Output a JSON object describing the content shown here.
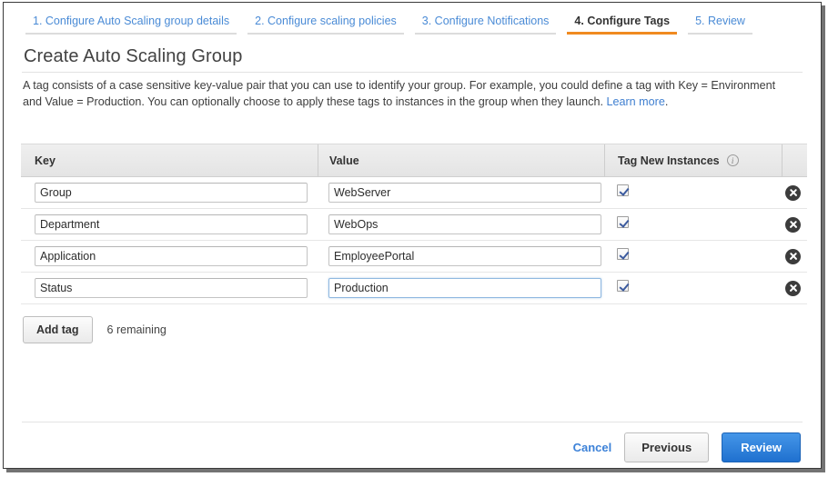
{
  "wizard": {
    "tabs": [
      {
        "label": "1. Configure Auto Scaling group details",
        "active": false
      },
      {
        "label": "2. Configure scaling policies",
        "active": false
      },
      {
        "label": "3. Configure Notifications",
        "active": false
      },
      {
        "label": "4. Configure Tags",
        "active": true
      },
      {
        "label": "5. Review",
        "active": false
      }
    ]
  },
  "page": {
    "title": "Create Auto Scaling Group",
    "description_part1": "A tag consists of a case sensitive key-value pair that you can use to identify your group. For example, you could define a tag with Key = Environment and Value = Production. You can optionally choose to apply these tags to instances in the group when they launch. ",
    "description_link": "Learn more",
    "description_part2": "."
  },
  "table": {
    "headers": {
      "key": "Key",
      "value": "Value",
      "tag_new_instances": "Tag New Instances",
      "info_glyph": "i"
    },
    "rows": [
      {
        "key": "Group",
        "value": "WebServer",
        "tag_new_instances": true,
        "focused": false
      },
      {
        "key": "Department",
        "value": "WebOps",
        "tag_new_instances": true,
        "focused": false
      },
      {
        "key": "Application",
        "value": "EmployeePortal",
        "tag_new_instances": true,
        "focused": false
      },
      {
        "key": "Status",
        "value": "Production",
        "tag_new_instances": true,
        "focused": true
      }
    ],
    "key_placeholder": "",
    "value_placeholder": ""
  },
  "actions": {
    "add_tag": "Add tag",
    "remaining": "6 remaining"
  },
  "footer": {
    "cancel": "Cancel",
    "previous": "Previous",
    "review": "Review"
  },
  "colors": {
    "accent_orange": "#f08a20",
    "link_blue": "#3f7fd0",
    "primary_button": "#1f70cf",
    "header_gray": "#e4e4e4"
  }
}
